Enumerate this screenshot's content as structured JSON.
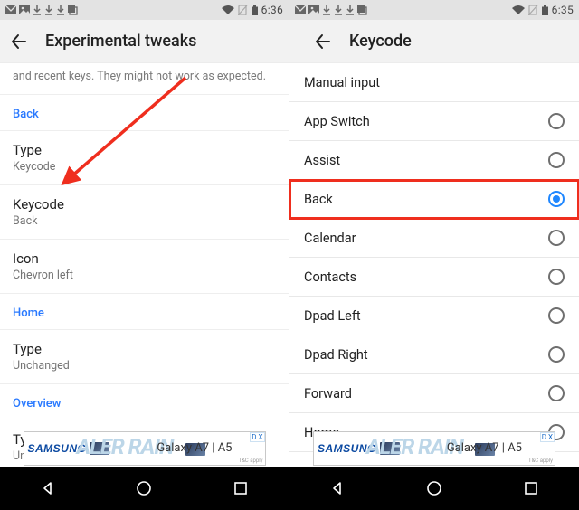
{
  "left": {
    "status": {
      "time": "6:36"
    },
    "appbar": {
      "title": "Experimental tweaks"
    },
    "truncated_hint": "and recent keys. They might not work as expected.",
    "sections": {
      "back": {
        "label": "Back",
        "type": {
          "title": "Type",
          "value": "Keycode"
        },
        "keycode": {
          "title": "Keycode",
          "value": "Back"
        },
        "icon": {
          "title": "Icon",
          "value": "Chevron left"
        }
      },
      "home": {
        "label": "Home",
        "type": {
          "title": "Type",
          "value": "Unchanged"
        }
      },
      "overview": {
        "label": "Overview",
        "type": {
          "title": "Type",
          "value": "Unchanged"
        }
      }
    },
    "ad": {
      "brand": "SAMSUNG",
      "ghost": "ALER RAIN",
      "product": "Galaxy A7 | A5",
      "corner": "D X",
      "tac": "T&C apply"
    }
  },
  "right": {
    "status": {
      "time": "6:35"
    },
    "appbar": {
      "title": "Keycode"
    },
    "options": [
      {
        "label": "Manual input",
        "has_radio": false,
        "checked": false
      },
      {
        "label": "App Switch",
        "has_radio": true,
        "checked": false
      },
      {
        "label": "Assist",
        "has_radio": true,
        "checked": false
      },
      {
        "label": "Back",
        "has_radio": true,
        "checked": true,
        "highlighted": true
      },
      {
        "label": "Calendar",
        "has_radio": true,
        "checked": false
      },
      {
        "label": "Contacts",
        "has_radio": true,
        "checked": false
      },
      {
        "label": "Dpad Left",
        "has_radio": true,
        "checked": false
      },
      {
        "label": "Dpad Right",
        "has_radio": true,
        "checked": false
      },
      {
        "label": "Forward",
        "has_radio": true,
        "checked": false
      },
      {
        "label": "Home",
        "has_radio": true,
        "checked": false
      }
    ],
    "ad": {
      "brand": "SAMSUNG",
      "ghost": "ALER RAIN",
      "product": "Galaxy A7 | A5",
      "corner": "D X",
      "tac": "T&C apply"
    }
  }
}
